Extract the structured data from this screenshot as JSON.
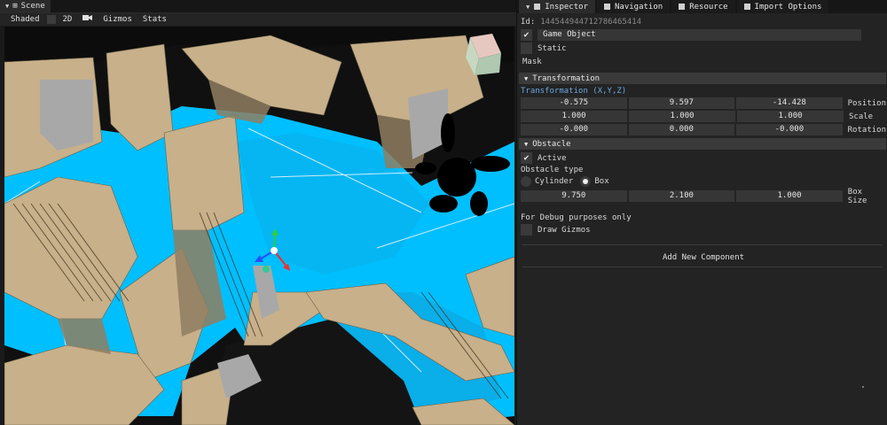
{
  "scene": {
    "tab_label": "Scene",
    "toolbar": {
      "shaded": "Shaded",
      "twod": "2D",
      "gizmos": "Gizmos",
      "stats": "Stats"
    }
  },
  "inspector": {
    "tabs": [
      "Inspector",
      "Navigation",
      "Resource",
      "Import Options"
    ],
    "id_label": "Id:",
    "id_value": "144544944712786465414",
    "game_object": {
      "checked": true,
      "label": "Game Object"
    },
    "static": {
      "checked": false,
      "label": "Static"
    },
    "mask_label": "Mask",
    "transformation": {
      "header": "Transformation",
      "subtitle": "Transformation (X,Y,Z)",
      "position": {
        "values": [
          "-0.575",
          "9.597",
          "-14.428"
        ],
        "label": "Position"
      },
      "scale": {
        "values": [
          "1.000",
          "1.000",
          "1.000"
        ],
        "label": "Scale"
      },
      "rotation": {
        "values": [
          "-0.000",
          "0.000",
          "-0.000"
        ],
        "label": "Rotation"
      }
    },
    "obstacle": {
      "header": "Obstacle",
      "active": {
        "checked": true,
        "label": "Active"
      },
      "type_label": "Obstacle type",
      "cylinder": {
        "selected": false,
        "label": "Cylinder"
      },
      "box": {
        "selected": true,
        "label": "Box"
      },
      "box_size": {
        "values": [
          "9.750",
          "2.100",
          "1.000"
        ],
        "label": "Box Size"
      },
      "debug_label": "For Debug purposes only",
      "draw_gizmos": {
        "checked": false,
        "label": "Draw Gizmos"
      }
    },
    "add_component": "Add New Component"
  },
  "colors": {
    "navmesh": "#00bfff",
    "walls": "#c8b48c",
    "accent_blue": "#6aa8e0",
    "panel_bg": "#232323"
  }
}
